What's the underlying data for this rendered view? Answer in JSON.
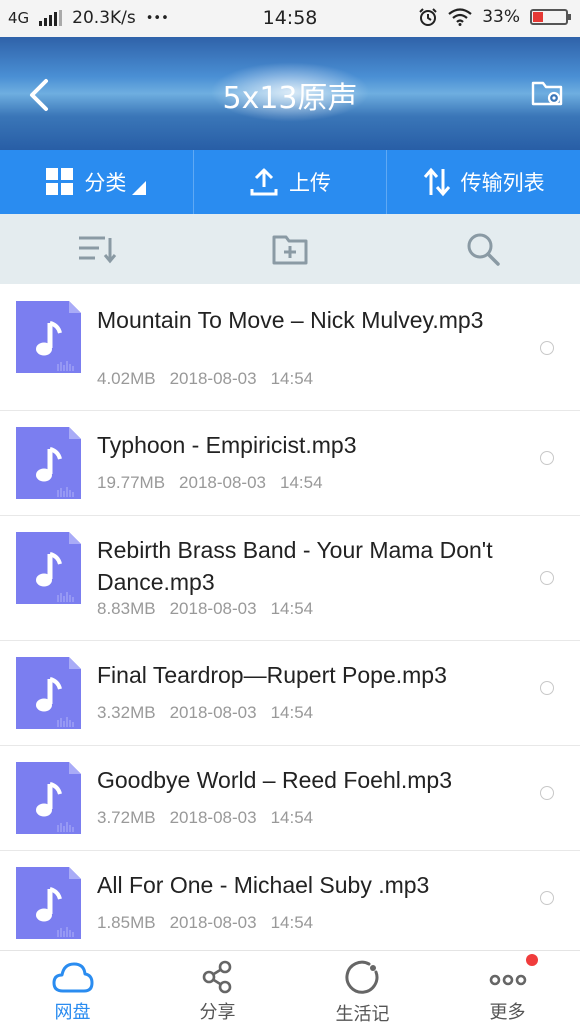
{
  "status_bar": {
    "network": "4G",
    "speed": "20.3K/s",
    "more": "•••",
    "time": "14:58",
    "battery": "33%"
  },
  "header": {
    "title": "5x13原声",
    "back_icon": "chevron-left-icon",
    "settings_icon": "folder-settings-icon"
  },
  "actions": {
    "category": "分类",
    "upload": "上传",
    "transfer": "传输列表"
  },
  "toolbar": {
    "sort_icon": "sort-icon",
    "new_folder_icon": "folder-add-icon",
    "search_icon": "search-icon"
  },
  "files": [
    {
      "name": "Mountain To Move  –  Nick Mulvey.mp3",
      "size": "4.02MB",
      "date": "2018-08-03",
      "time": "14:54"
    },
    {
      "name": "Typhoon - Empiricist.mp3",
      "size": "19.77MB",
      "date": "2018-08-03",
      "time": "14:54"
    },
    {
      "name": "Rebirth Brass Band - Your Mama Don't Dance.mp3",
      "size": "8.83MB",
      "date": "2018-08-03",
      "time": "14:54"
    },
    {
      "name": "Final Teardrop—Rupert Pope.mp3",
      "size": "3.32MB",
      "date": "2018-08-03",
      "time": "14:54"
    },
    {
      "name": "Goodbye World  –  Reed Foehl.mp3",
      "size": "3.72MB",
      "date": "2018-08-03",
      "time": "14:54"
    },
    {
      "name": "All For One - Michael Suby .mp3",
      "size": "1.85MB",
      "date": "2018-08-03",
      "time": "14:54"
    }
  ],
  "bottom_nav": [
    {
      "label": "网盘",
      "icon": "cloud-icon",
      "active": true
    },
    {
      "label": "分享",
      "icon": "share-icon",
      "active": false
    },
    {
      "label": "生活记",
      "icon": "life-record-icon",
      "active": false
    },
    {
      "label": "更多",
      "icon": "more-icon",
      "active": false
    }
  ],
  "colors": {
    "accent": "#2a8cf0",
    "file_icon": "#7b7ef0",
    "notification_dot": "#f03c3c"
  }
}
